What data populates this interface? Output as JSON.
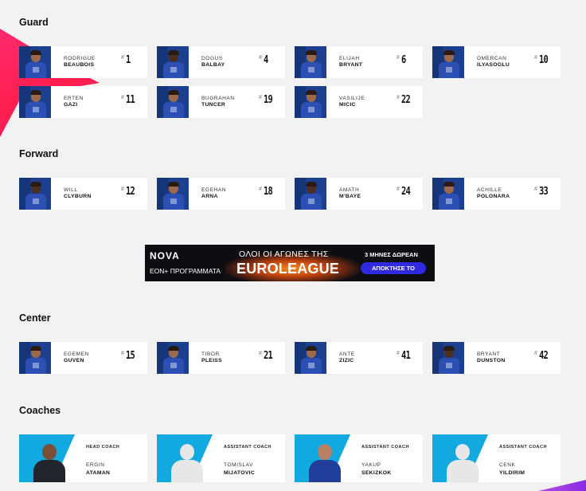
{
  "sections": {
    "guard": "Guard",
    "forward": "Forward",
    "center": "Center",
    "coaches": "Coaches"
  },
  "guards": [
    {
      "first": "Rodrigue",
      "last": "Beaubois",
      "number": "1"
    },
    {
      "first": "Dogus",
      "last": "Balbay",
      "number": "4"
    },
    {
      "first": "Elijah",
      "last": "Bryant",
      "number": "6"
    },
    {
      "first": "Omercan",
      "last": "Ilyasoglu",
      "number": "10"
    },
    {
      "first": "Erten",
      "last": "Gazi",
      "number": "11"
    },
    {
      "first": "Bugrahan",
      "last": "Tuncer",
      "number": "19"
    },
    {
      "first": "Vasilije",
      "last": "Micic",
      "number": "22"
    }
  ],
  "forwards": [
    {
      "first": "Will",
      "last": "Clyburn",
      "number": "12"
    },
    {
      "first": "Egehan",
      "last": "Arna",
      "number": "18"
    },
    {
      "first": "Amath",
      "last": "M'Baye",
      "number": "24"
    },
    {
      "first": "Achille",
      "last": "Polonara",
      "number": "33"
    }
  ],
  "centers": [
    {
      "first": "Egemen",
      "last": "Guven",
      "number": "15"
    },
    {
      "first": "Tibor",
      "last": "Pleiss",
      "number": "21"
    },
    {
      "first": "Ante",
      "last": "Zizic",
      "number": "41"
    },
    {
      "first": "Bryant",
      "last": "Dunston",
      "number": "42"
    }
  ],
  "coaches": [
    {
      "role": "Head Coach",
      "first": "Ergin",
      "last": "Ataman"
    },
    {
      "role": "Assistant Coach",
      "first": "Tomislav",
      "last": "Mijatovic"
    },
    {
      "role": "Assistant Coach",
      "first": "Yakup",
      "last": "Sekizkok"
    },
    {
      "role": "Assistant Coach",
      "first": "Cenk",
      "last": "Yildirim"
    }
  ],
  "number_prefix": "#",
  "ad": {
    "brand": "NOVA",
    "sub": "ΕΟΝ+ ΠΡΟΓΡΑΜΜΑΤΑ",
    "line1": "ΟΛΟΙ ΟΙ ΑΓΩΝΕΣ ΤΗΣ",
    "line2": "EUROLEAGUE",
    "offer": "3 ΜΗΝΕΣ ΔΩΡΕΑΝ",
    "cta": "ΑΠΟΚΤΗΣΕ ΤΟ"
  },
  "colors": {
    "accent_pink": "#ff2a6d",
    "team_blue": "#1d3f8f",
    "coach_blue": "#12a8e0",
    "ad_cta": "#2f2ae0"
  }
}
